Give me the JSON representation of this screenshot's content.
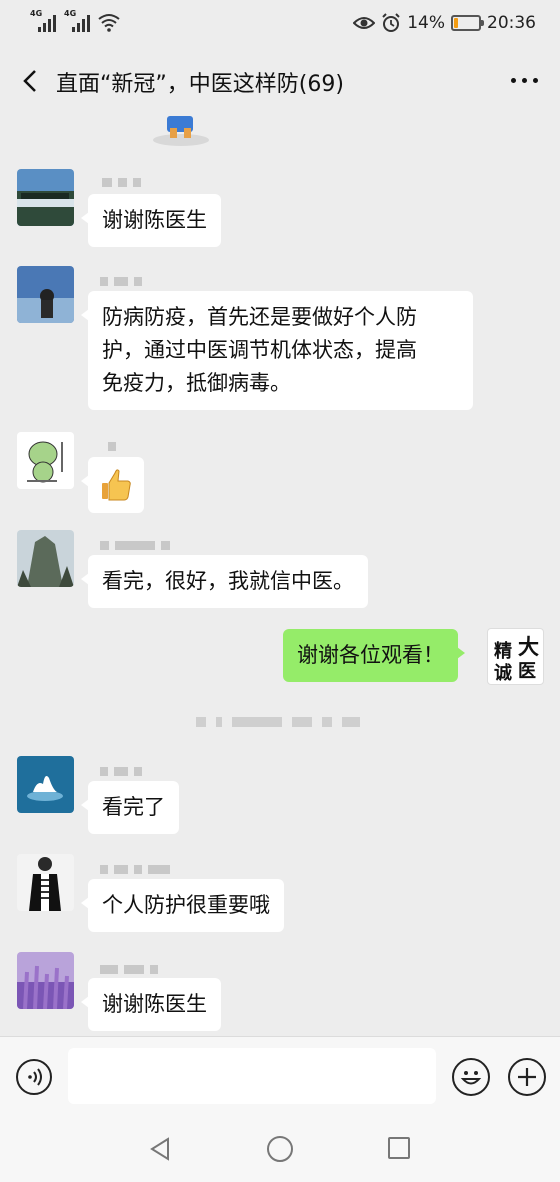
{
  "status": {
    "signal1_tag": "4G",
    "signal2_tag": "4G",
    "battery_percent": "14%",
    "battery_level": 0.14,
    "time": "20:36",
    "icons": [
      "eye-icon",
      "alarm-icon",
      "wifi-icon",
      "battery-icon"
    ]
  },
  "header": {
    "title": "直面“新冠”，中医这样防(69)",
    "back_icon": "chevron-left-icon",
    "more_icon": "more-dots-icon"
  },
  "messages": [
    {
      "text": "谢谢陈医生",
      "sender": "other"
    },
    {
      "text": "防病防疫，首先还是要做好个人防\n护，通过中医调节机体状态，提高\n免疫力，抵御病毒。",
      "sender": "other"
    },
    {
      "text": "",
      "sender": "other",
      "sticker": "thumbs-up-icon"
    },
    {
      "text": "看完，很好，我就信中医。",
      "sender": "other"
    },
    {
      "text": "谢谢各位观看！",
      "sender": "me"
    },
    {
      "text": "看完了",
      "sender": "other"
    },
    {
      "text": "个人防护很重要哦",
      "sender": "other"
    },
    {
      "text": "谢谢陈医生",
      "sender": "other"
    }
  ],
  "my_avatar": {
    "chars": [
      "大",
      "医",
      "精",
      "诚"
    ]
  },
  "colors": {
    "background": "#ededed",
    "my_bubble": "#95ec69",
    "other_bubble": "#ffffff",
    "battery": "#f39c12"
  },
  "input": {
    "value": "",
    "placeholder": ""
  }
}
